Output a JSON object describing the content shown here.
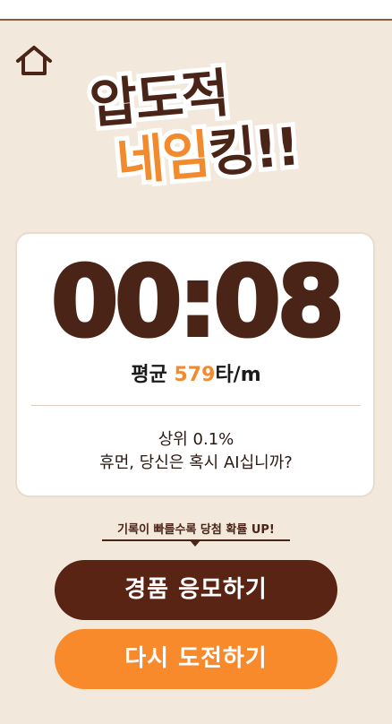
{
  "header": {
    "home_icon": "home-icon"
  },
  "logo": {
    "line1": "압도적",
    "line2_orange": "네임",
    "line2_brown": "킹!!"
  },
  "result": {
    "timer": "00:08",
    "avg_label": "평균 ",
    "avg_value": "579",
    "avg_unit": "타/m",
    "rank_line1": "상위 0.1%",
    "rank_line2": "휴먼, 당신은 혹시 AI십니까?"
  },
  "hint": "기록이 빠를수록 당첨 확률 UP!",
  "buttons": {
    "apply": "경품 응모하기",
    "retry": "다시 도전하기"
  },
  "colors": {
    "brown": "#4a2417",
    "orange": "#f28a2e",
    "background": "#f3e8dc"
  }
}
